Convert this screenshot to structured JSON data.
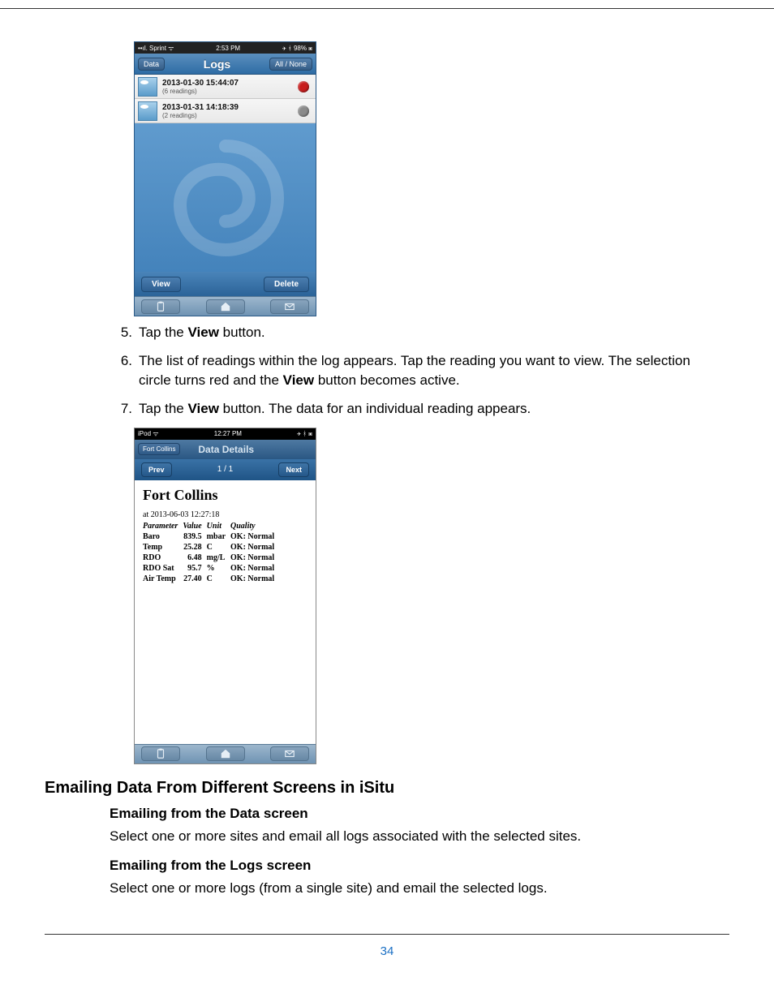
{
  "page_number": "34",
  "phone1": {
    "status_left": "••ıl. Sprint  ᯤ",
    "status_time": "2:53 PM",
    "status_right": "✈ ᚼ 98% ▣",
    "nav_back": "Data",
    "nav_title": "Logs",
    "nav_right": "All / None",
    "rows": [
      {
        "ts": "2013-01-30 15:44:07",
        "sub": "(6 readings)",
        "dot": "#c81e1e"
      },
      {
        "ts": "2013-01-31 14:18:39",
        "sub": "(2 readings)",
        "dot": "#8a8a8a"
      }
    ],
    "view_btn": "View",
    "delete_btn": "Delete"
  },
  "steps": {
    "s5_num": "5.",
    "s5_a": "Tap the ",
    "s5_b": "View",
    "s5_c": " button.",
    "s6_num": "6.",
    "s6_a": "The list of readings within the log appears. Tap the reading you want to view. The selection circle turns red and the ",
    "s6_b": "View",
    "s6_c": " button becomes active.",
    "s7_num": "7.",
    "s7_a": "Tap the ",
    "s7_b": "View",
    "s7_c": " button. The data for an individual reading appears."
  },
  "phone2": {
    "status_left": "iPod ᯤ",
    "status_time": "12:27 PM",
    "status_right": "✈ ᚼ ▣",
    "nav_back": "Fort Collins",
    "nav_title": "Data Details",
    "prev": "Prev",
    "pager": "1 / 1",
    "next": "Next",
    "title": "Fort Collins",
    "timestamp": "at 2013-06-03 12:27:18",
    "headers": {
      "p": "Parameter",
      "v": "Value",
      "u": "Unit",
      "q": "Quality"
    },
    "rows": [
      {
        "p": "Baro",
        "v": "839.5",
        "u": "mbar",
        "q": "OK: Normal"
      },
      {
        "p": "Temp",
        "v": "25.28",
        "u": "C",
        "q": "OK: Normal"
      },
      {
        "p": "RDO",
        "v": "6.48",
        "u": "mg/L",
        "q": "OK: Normal"
      },
      {
        "p": "RDO Sat",
        "v": "95.7",
        "u": "%",
        "q": "OK: Normal"
      },
      {
        "p": "Air Temp",
        "v": "27.40",
        "u": "C",
        "q": "OK: Normal"
      }
    ]
  },
  "section_title": "Emailing Data From Different Screens in iSitu",
  "sub1_h": "Emailing from the Data screen",
  "sub1_p": "Select one or more sites and email all logs associated with the selected sites.",
  "sub2_h": "Emailing from the Logs screen",
  "sub2_p": "Select one or more logs (from a single site) and email the selected logs.",
  "chart_data": {
    "type": "table",
    "title": "Fort Collins — Data Details at 2013-06-03 12:27:18",
    "columns": [
      "Parameter",
      "Value",
      "Unit",
      "Quality"
    ],
    "rows": [
      [
        "Baro",
        839.5,
        "mbar",
        "OK: Normal"
      ],
      [
        "Temp",
        25.28,
        "C",
        "OK: Normal"
      ],
      [
        "RDO",
        6.48,
        "mg/L",
        "OK: Normal"
      ],
      [
        "RDO Sat",
        95.7,
        "%",
        "OK: Normal"
      ],
      [
        "Air Temp",
        27.4,
        "C",
        "OK: Normal"
      ]
    ]
  }
}
